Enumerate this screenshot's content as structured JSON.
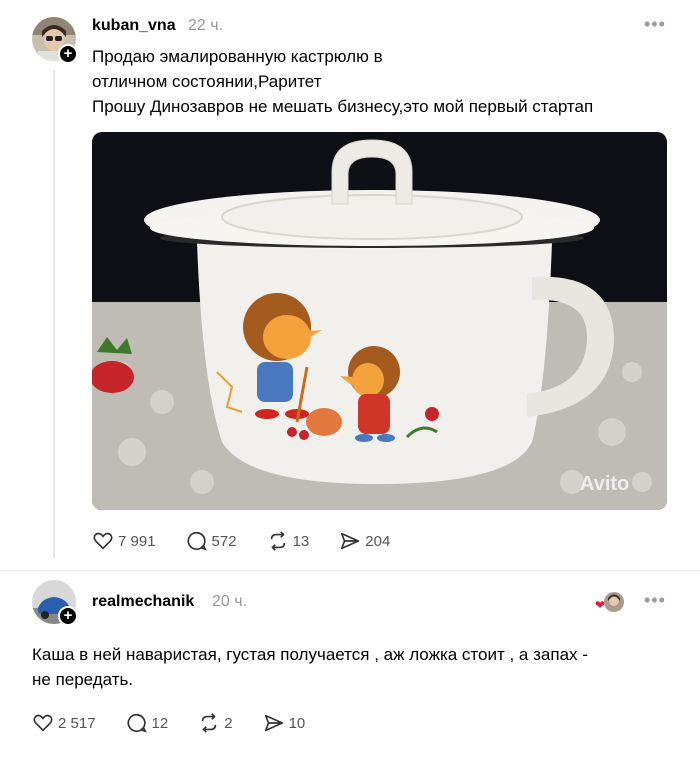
{
  "post1": {
    "username": "kuban_vna",
    "time": "22 ч.",
    "text_lines": [
      "Продаю эмалированную кастрюлю в",
      "отличном состоянии,Раритет",
      "Прошу Динозавров не мешать бизнесу,это мой первый стартап"
    ],
    "image_watermark": "Avito",
    "likes": "7 991",
    "comments": "572",
    "reposts": "13",
    "shares": "204"
  },
  "post2": {
    "username": "realmechanik",
    "time": "20 ч.",
    "text_lines": [
      "Каша в ней наваристая, густая получается , аж ложка стоит , а запах -",
      "не передать."
    ],
    "likes": "2 517",
    "comments": "12",
    "reposts": "2",
    "shares": "10"
  },
  "colors": {
    "muted": "#999999",
    "icon": "#555555",
    "like_red": "#e8173c"
  }
}
